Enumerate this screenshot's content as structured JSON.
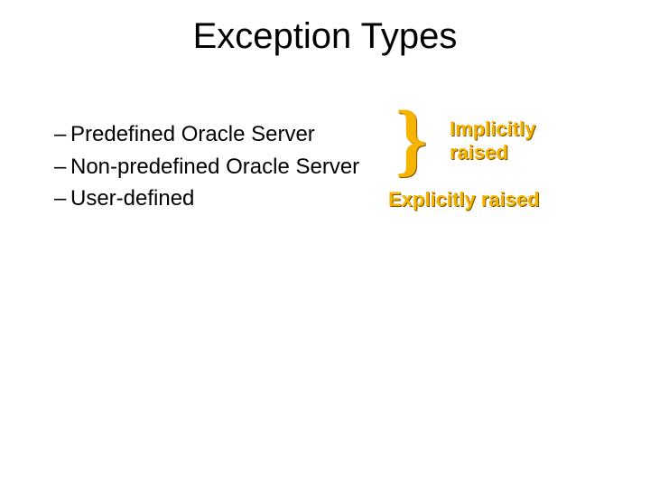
{
  "title": "Exception Types",
  "bullets": {
    "b1": "Predefined Oracle Server",
    "b2": "Non-predefined Oracle Server",
    "b3": "User-defined"
  },
  "brace": "}",
  "implicit": {
    "line1": "Implicitly",
    "line2": "raised"
  },
  "explicit": "Explicitly raised"
}
